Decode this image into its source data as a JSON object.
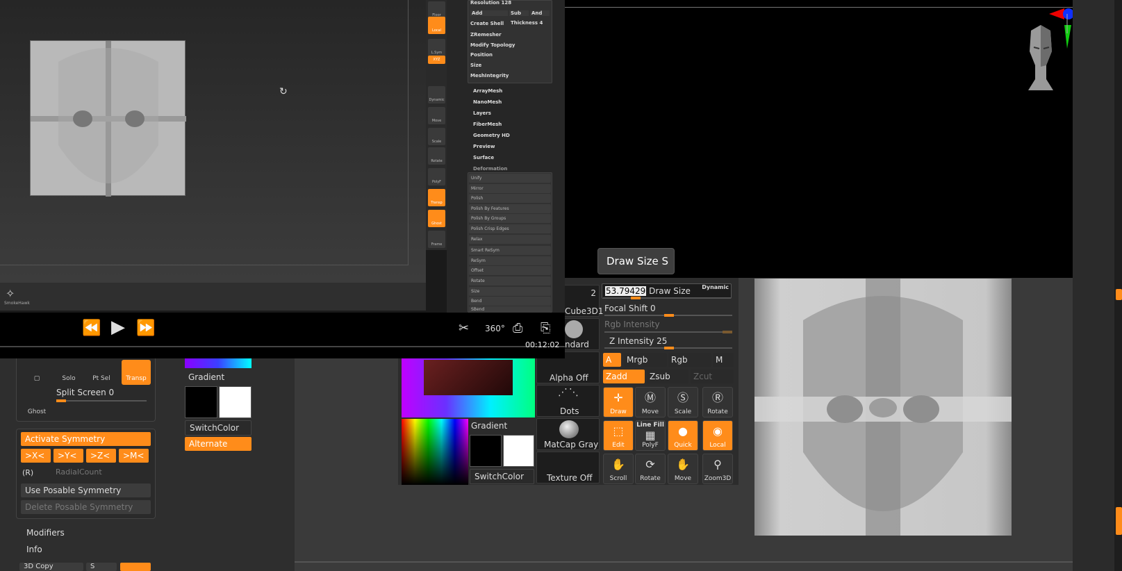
{
  "video": {
    "resolution_label": "Resolution 128",
    "menu_buttons": [
      "Add",
      "Sub",
      "And"
    ],
    "create_shell": "Create Shell",
    "thickness": "Thickness 4",
    "geometry_items": [
      "ZRemesher",
      "Modify Topology",
      "Position",
      "Size",
      "MeshIntegrity"
    ],
    "tool_items": [
      "ArrayMesh",
      "NanoMesh",
      "Layers",
      "FiberMesh",
      "Geometry HD",
      "Preview",
      "Surface"
    ],
    "deformation_label": "Deformation",
    "deformation_items": [
      "Unify",
      "Mirror",
      "Polish",
      "Polish By Features",
      "Polish By Groups",
      "Polish Crisp Edges",
      "Relax",
      "Smart ReSym",
      "ReSym",
      "Offset",
      "Rotate",
      "Size",
      "Bend",
      "SBend"
    ],
    "toolbar_items": [
      "Floor",
      "Local",
      "L.Sym",
      "XYZ",
      "Dynamic",
      "Move",
      "Scale",
      "Rotate",
      "PolyF",
      "Transp",
      "Ghost",
      "Frame"
    ],
    "logo_text": "SmokeHawk",
    "time": "00:12:02"
  },
  "left_panel": {
    "solo": "Solo",
    "pt_sel": "Pt Sel",
    "transp": "Transp",
    "ghost": "Ghost",
    "split_screen": "Split Screen 0",
    "activate_symmetry": "Activate Symmetry",
    "axes": [
      ">X<",
      ">Y<",
      ">Z<",
      ">M<"
    ],
    "r_label": "(R)",
    "radial_count": "RadialCount",
    "use_posable": "Use Posable Symmetry",
    "delete_posable": "Delete Posable Symmetry",
    "modifiers": "Modifiers",
    "info": "Info",
    "copy_3d": "3D Copy",
    "s_label": "S"
  },
  "color_column": {
    "gradient": "Gradient",
    "switch_color": "SwitchColor",
    "alternate": "Alternate"
  },
  "palette": {
    "tooltip": "Draw Size  S",
    "tool_count": "2",
    "tool_name": "Cube3D1",
    "brush_name": "ndard",
    "alpha": "Alpha Off",
    "stroke": "Dots",
    "material": "MatCap Gray",
    "texture": "Texture Off",
    "gradient": "Gradient",
    "switch_color": "SwitchColor",
    "draw_size_value": "53.79429",
    "draw_size_label": "Draw Size",
    "dynamic": "Dynamic",
    "focal_shift": "Focal Shift 0",
    "rgb_intensity": "Rgb Intensity",
    "z_intensity": "Z Intensity 25",
    "mode_buttons": [
      "A",
      "Mrgb",
      "Rgb",
      "M"
    ],
    "z_buttons": [
      "Zadd",
      "Zsub",
      "Zcut"
    ],
    "tools_row1": [
      "Draw",
      "Move",
      "Scale",
      "Rotate"
    ],
    "tools_row2": [
      "Edit",
      "PolyF",
      "Quick",
      "Local"
    ],
    "line_fill": "Line Fill",
    "tools_row3": [
      "Scroll",
      "Rotate",
      "Move",
      "Zoom3D"
    ]
  },
  "colors": {
    "accent": "#ff8c1a",
    "panel": "#2c2c2c",
    "viewport": "#3a3a3a"
  }
}
